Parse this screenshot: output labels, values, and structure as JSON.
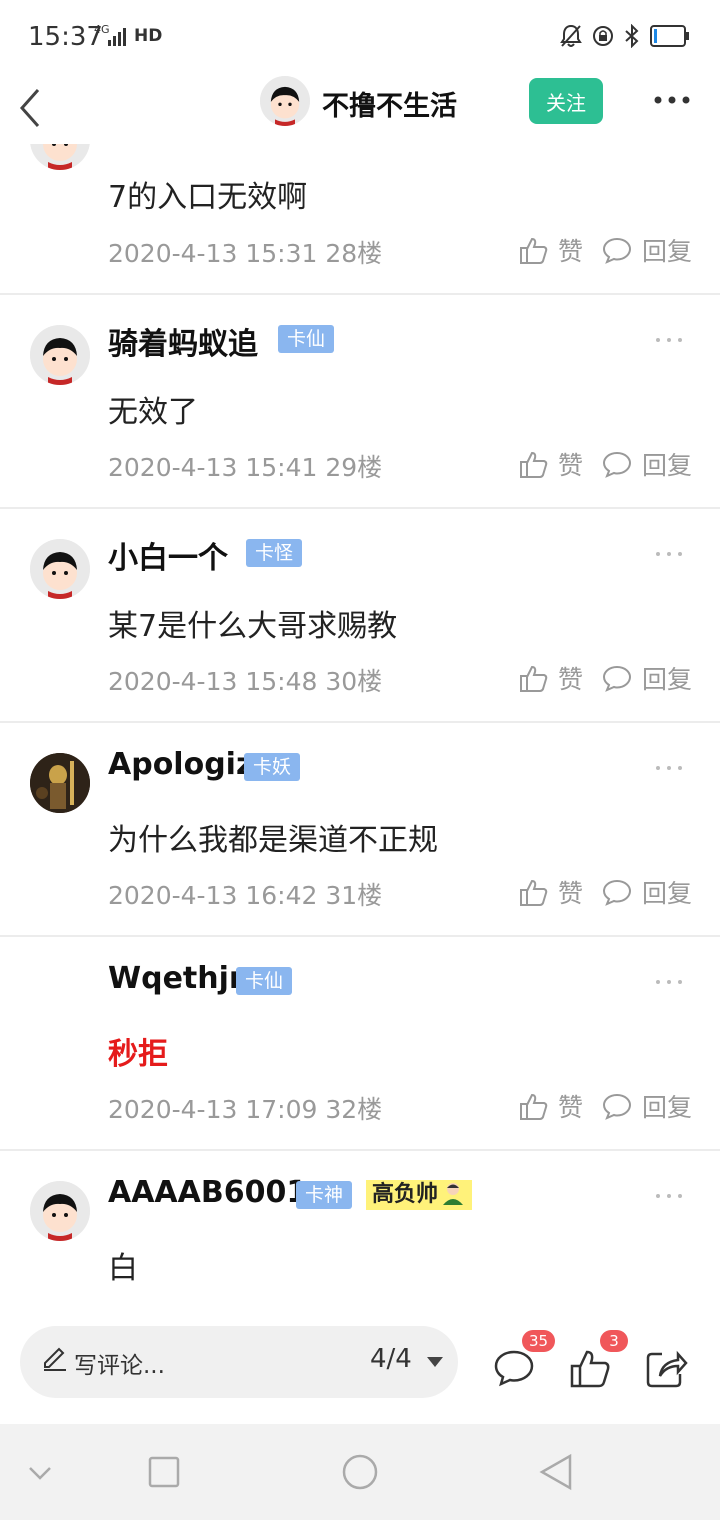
{
  "status_bar": {
    "time": "15:37",
    "network": "4G",
    "hd": "HD"
  },
  "header": {
    "title": "不撸不生活",
    "follow_label": "关注"
  },
  "posts": [
    {
      "content": "7的入口无效啊",
      "date": "2020-4-13 15:31",
      "floor": "28楼",
      "like_label": "赞",
      "reply_label": "回复"
    },
    {
      "username": "骑着蚂蚁追",
      "badge": "卡仙",
      "content": "无效了",
      "date": "2020-4-13 15:41",
      "floor": "29楼",
      "like_label": "赞",
      "reply_label": "回复"
    },
    {
      "username": "小白一个",
      "badge": "卡怪",
      "content": "某7是什么大哥求赐教",
      "date": "2020-4-13 15:48",
      "floor": "30楼",
      "like_label": "赞",
      "reply_label": "回复"
    },
    {
      "username": "Apologiz",
      "badge": "卡妖",
      "content": "为什么我都是渠道不正规",
      "date": "2020-4-13 16:42",
      "floor": "31楼",
      "like_label": "赞",
      "reply_label": "回复"
    },
    {
      "username": "Wqethjn",
      "badge": "卡仙",
      "content": "秒拒",
      "date": "2020-4-13 17:09",
      "floor": "32楼",
      "like_label": "赞",
      "reply_label": "回复"
    },
    {
      "username": "AAAAB6001",
      "badge": "卡神",
      "honor_badge": "高负帅",
      "content": "白"
    }
  ],
  "bottom_bar": {
    "comment_placeholder": "写评论...",
    "page_indicator": "4/4",
    "comment_count": "35",
    "like_count": "3"
  },
  "colors": {
    "accent": "#2dbf93",
    "badge": "#8ab6ef",
    "count_badge": "#f0575a",
    "highlight_text": "#e51b1b"
  }
}
